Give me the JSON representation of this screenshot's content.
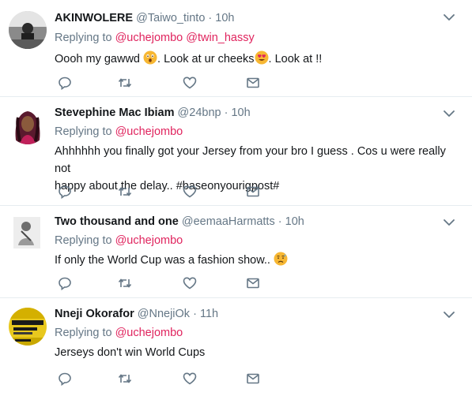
{
  "tweets": [
    {
      "name": "AKINWOLERE",
      "handle": "@Taiwo_tinto",
      "dot": "·",
      "time": "10h",
      "replying_prefix": "Replying to ",
      "mention1": "@uchejombo",
      "mention2": "@twin_hassy",
      "text_part1": "Oooh my gawwd ",
      "emoji1": "astonished-face",
      "text_part2": ". Look at ur cheeks",
      "emoji2": "heart-eyes-face",
      "text_part3": ". Look at !!"
    },
    {
      "name": "Stevephine Mac Ibiam",
      "handle": "@24bnp",
      "dot": "·",
      "time": "10h",
      "replying_prefix": "Replying to ",
      "mention1": "@uchejombo",
      "text_line1": "Ahhhhhh you finally got your Jersey from your bro I guess . Cos u were really not",
      "text_line2": "happy about the delay.. #baseonyourigpost#"
    },
    {
      "name": "Two thousand and one",
      "handle": "@eemaaHarmatts",
      "dot": "·",
      "time": "10h",
      "replying_prefix": "Replying to ",
      "mention1": "@uchejombo",
      "text_part1": "If only the World Cup was a fashion show.. ",
      "emoji1": "disappointed-relieved-face"
    },
    {
      "name": "Nneji Okorafor",
      "handle": "@NnejiOk",
      "dot": "·",
      "time": "11h",
      "replying_prefix": "Replying to ",
      "mention1": "@uchejombo",
      "text_part1": "Jerseys don't win World Cups"
    }
  ],
  "icons": {
    "reply": "reply-icon",
    "retweet": "retweet-icon",
    "like": "heart-icon",
    "dm": "envelope-icon",
    "more": "chevron-down-icon"
  },
  "colors": {
    "name": "#14171a",
    "meta": "#657786",
    "mention": "#e0245e",
    "divider": "#e6ecf0",
    "icon": "#657786"
  }
}
